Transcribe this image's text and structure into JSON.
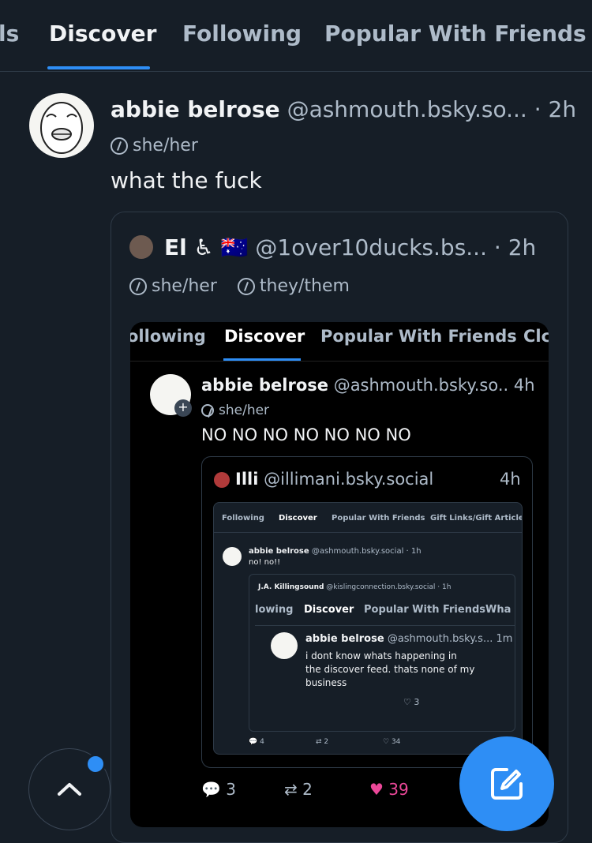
{
  "tabs": [
    "ls",
    "Discover",
    "Following",
    "Popular With Friends"
  ],
  "post": {
    "name": "abbie belrose",
    "handle": "@ashmouth.bsky.so...",
    "time": "· 2h",
    "pronoun": "she/her",
    "text": "what the fuck"
  },
  "quote1": {
    "name": "El",
    "emoji": "♿ 🇦🇺",
    "handle": "@1over10ducks.bs...",
    "time": "· 2h",
    "pronoun1": "she/her",
    "pronoun2": "they/them"
  },
  "shot1": {
    "tabs": [
      "ollowing",
      "Discover",
      "Popular With Friends",
      "Clc"
    ],
    "name": "abbie belrose",
    "handle": "@ashmouth.bsky.so..",
    "time": "4h",
    "pronoun": "she/her",
    "text": "NO NO NO NO NO NO NO",
    "quote_name": "Illi",
    "quote_handle": "@illimani.bsky.social",
    "quote_time": "4h",
    "replies": "3",
    "reposts": "2",
    "likes": "39"
  },
  "shot2": {
    "tabs": [
      "Following",
      "Discover",
      "Popular With Friends",
      "Gift Links/Gift Articles"
    ],
    "name": "abbie belrose",
    "handle": "@ashmouth.bsky.social · 1h",
    "text": "no! no!!",
    "quote_name": "J.A. Killingsound",
    "quote_handle": "@kislingconnection.bsky.social · 1h",
    "inner_tabs": [
      "lowing",
      "Discover",
      "Popular With Friends",
      "Wha"
    ],
    "inner_name": "abbie belrose",
    "inner_handle": "@ashmouth.bsky.s... 1m",
    "inner_text_1": "i dont know whats happening in",
    "inner_text_2": "the discover feed. thats none of my",
    "inner_text_3": "business",
    "inner_likes": "3",
    "replies": "4",
    "reposts": "2",
    "likes": "34"
  },
  "colors": {
    "accent": "#2e8ef5",
    "like": "#ec4899",
    "bg": "#161e27"
  }
}
